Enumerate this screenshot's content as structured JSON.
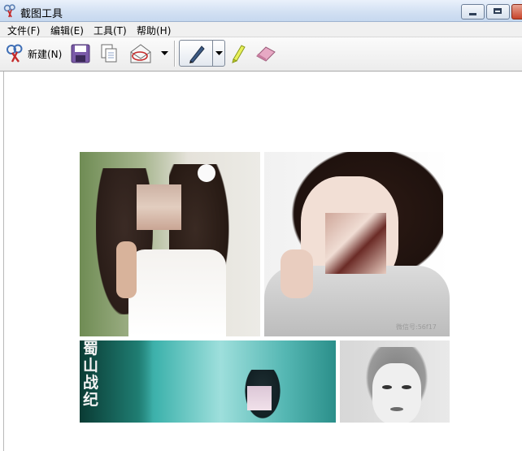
{
  "window": {
    "title": "截图工具",
    "icon": "scissors-icon"
  },
  "menu": [
    {
      "label": "文件(F)"
    },
    {
      "label": "编辑(E)"
    },
    {
      "label": "工具(T)"
    },
    {
      "label": "帮助(H)"
    }
  ],
  "toolbar": {
    "new_label": "新建(N)",
    "buttons": [
      "new-snip",
      "save",
      "copy",
      "send-email",
      "pen",
      "highlighter",
      "eraser"
    ]
  },
  "images": [
    {
      "name": "portrait-girl-white-dress"
    },
    {
      "name": "portrait-girl-sweater",
      "watermark": "微信号:56f17"
    },
    {
      "name": "banner-shu-shan",
      "text": "蜀山战纪"
    },
    {
      "name": "pencil-sketch-portrait"
    }
  ],
  "colors": {
    "titlebar": "#d3e1f3",
    "menubar": "#f0f0f0",
    "canvas": "#ffffff"
  }
}
